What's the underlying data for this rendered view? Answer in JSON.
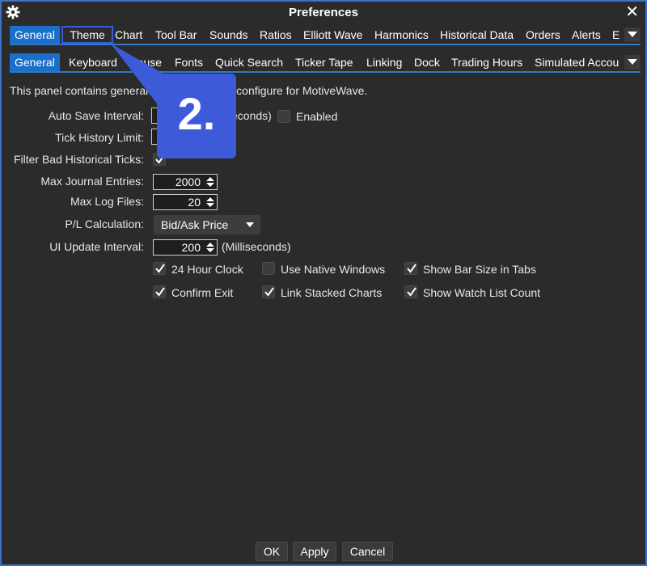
{
  "window": {
    "title": "Preferences"
  },
  "tabs_primary": [
    {
      "label": "General",
      "active": true
    },
    {
      "label": "Theme",
      "active": false,
      "highlighted": true
    },
    {
      "label": "Chart",
      "active": false
    },
    {
      "label": "Tool Bar",
      "active": false
    },
    {
      "label": "Sounds",
      "active": false
    },
    {
      "label": "Ratios",
      "active": false
    },
    {
      "label": "Elliott Wave",
      "active": false
    },
    {
      "label": "Harmonics",
      "active": false
    },
    {
      "label": "Historical Data",
      "active": false
    },
    {
      "label": "Orders",
      "active": false
    },
    {
      "label": "Alerts",
      "active": false
    },
    {
      "label": "E",
      "active": false
    }
  ],
  "tabs_secondary": [
    {
      "label": "General",
      "active": true
    },
    {
      "label": "Keyboard",
      "active": false
    },
    {
      "label": "Mouse",
      "active": false
    },
    {
      "label": "Fonts",
      "active": false
    },
    {
      "label": "Quick Search",
      "active": false
    },
    {
      "label": "Ticker Tape",
      "active": false
    },
    {
      "label": "Linking",
      "active": false
    },
    {
      "label": "Dock",
      "active": false
    },
    {
      "label": "Trading Hours",
      "active": false
    },
    {
      "label": "Simulated Accou",
      "active": false
    }
  ],
  "panel": {
    "description": "This panel contains general settings you can configure for MotiveWave.",
    "auto_save_label": "Auto Save Interval:",
    "auto_save_unit": "(Seconds)",
    "auto_save_enabled_label": "Enabled",
    "auto_save_enabled": false,
    "tick_history_label": "Tick History Limit:",
    "filter_ticks_label": "Filter Bad Historical Ticks:",
    "filter_ticks_checked": true,
    "max_journal_label": "Max Journal Entries:",
    "max_journal_value": "2000",
    "max_log_label": "Max Log Files:",
    "max_log_value": "20",
    "pl_label": "P/L Calculation:",
    "pl_value": "Bid/Ask Price",
    "ui_update_label": "UI Update Interval:",
    "ui_update_value": "200",
    "ui_update_unit": "(Milliseconds)",
    "options": [
      {
        "label": "24 Hour Clock",
        "checked": true
      },
      {
        "label": "Use Native Windows",
        "checked": false
      },
      {
        "label": "Show Bar Size in Tabs",
        "checked": true
      },
      {
        "label": "Confirm Exit",
        "checked": true
      },
      {
        "label": "Link Stacked Charts",
        "checked": true
      },
      {
        "label": "Show Watch List Count",
        "checked": true
      }
    ]
  },
  "buttons": {
    "ok": "OK",
    "apply": "Apply",
    "cancel": "Cancel"
  },
  "callout": {
    "text": "2."
  },
  "colors": {
    "accent": "#1a6fc8",
    "callout": "#3d5bd9",
    "background": "#2b2b2b"
  }
}
